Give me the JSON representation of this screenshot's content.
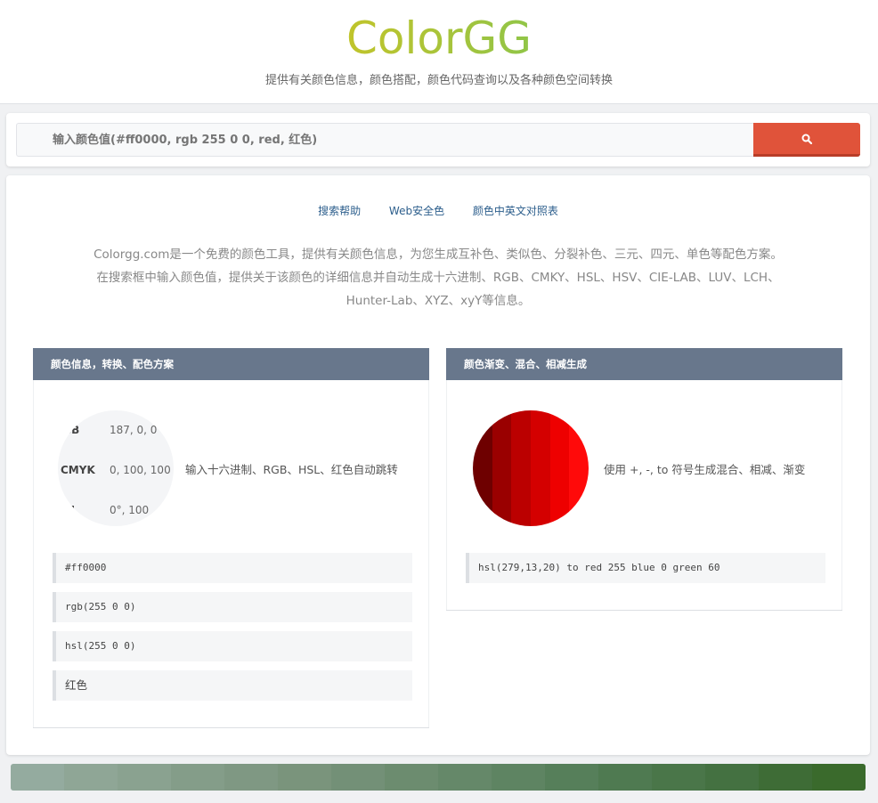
{
  "header": {
    "logo": "ColorGG",
    "tagline": "提供有关颜色信息，颜色搭配，颜色代码查询以及各种颜色空间转换"
  },
  "search": {
    "placeholder": "输入颜色值(#ff0000, rgb 255 0 0, red, 红色)",
    "button_icon": "search-icon"
  },
  "nav_links": [
    "搜索帮助",
    "Web安全色",
    "颜色中英文对照表"
  ],
  "description": {
    "line1": "Colorgg.com是一个免费的颜色工具，提供有关颜色信息，为您生成互补色、类似色、分裂补色、三元、四元、单色等配色方案。",
    "line2": "在搜索框中输入颜色值，提供关于该颜色的详细信息并自动生成十六进制、RGB、CMKY、HSL、HSV、CIE-LAB、LUV、LCH、",
    "line3": "Hunter-Lab、XYZ、xyY等信息。"
  },
  "left_panel": {
    "title": "颜色信息，转换、配色方案",
    "info": [
      {
        "key": "RGB",
        "value": "187, 0, 0"
      },
      {
        "key": "CMYK",
        "value": "0, 100, 100"
      },
      {
        "key": "HSL",
        "value": "0°, 100"
      }
    ],
    "hint": "输入十六进制、RGB、HSL、红色自动跳转",
    "examples": [
      "#ff0000",
      "rgb(255 0 0)",
      "hsl(255 0 0)",
      "红色"
    ]
  },
  "right_panel": {
    "title": "颜色渐变、混合、相减生成",
    "hint": "使用 +, -, to 符号生成混合、相减、渐变",
    "example": "hsl(279,13,20) to red 255 blue 0 green 60",
    "gradient_colors": [
      "#6e0000",
      "#9a0000",
      "#bb0000",
      "#d40000",
      "#ee0000",
      "#ff0a0a"
    ]
  },
  "palette_colors": [
    "#94ab9f",
    "#8fa696",
    "#8aa290",
    "#849d89",
    "#7f9883",
    "#7a947c",
    "#739077",
    "#6c8c6f",
    "#658869",
    "#5e8462",
    "#567f5a",
    "#4f7a51",
    "#4a7649",
    "#447141",
    "#3e6c36",
    "#3a6a2c"
  ]
}
